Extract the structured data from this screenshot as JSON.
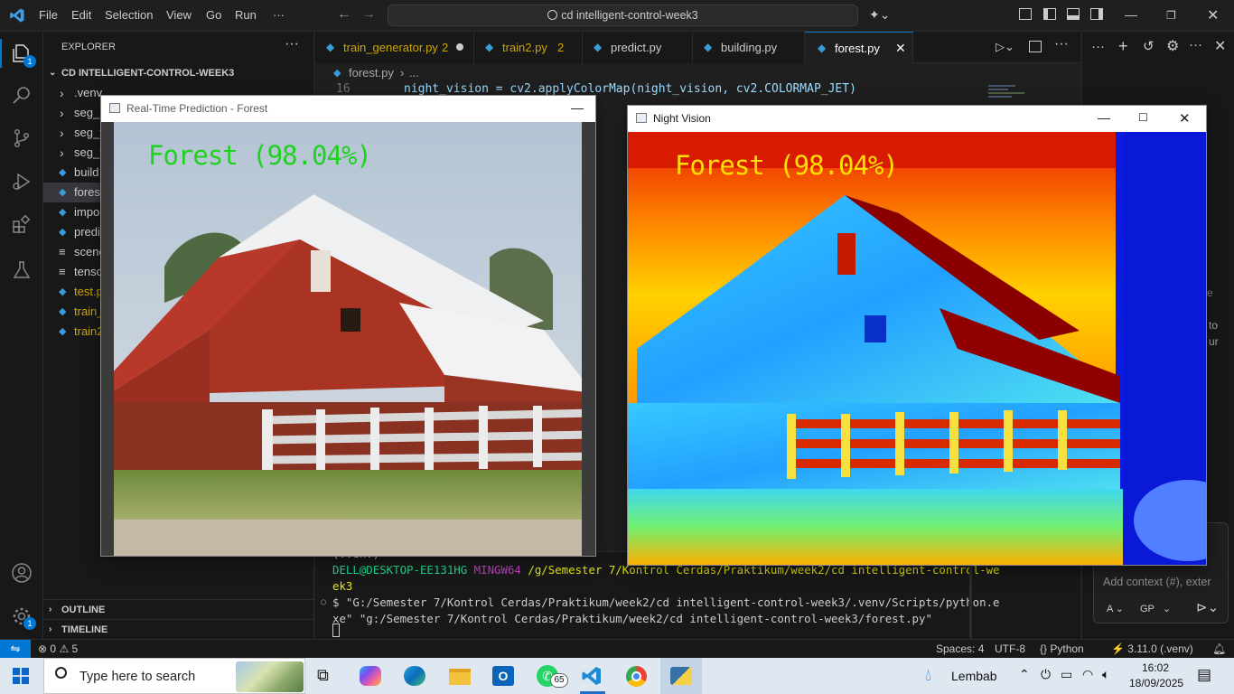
{
  "titlebar": {
    "menu": [
      "File",
      "Edit",
      "Selection",
      "View",
      "Go",
      "Run",
      "···"
    ],
    "search_text": "cd intelligent-control-week3"
  },
  "activity_bar": {
    "explorer_badge": "1",
    "settings_badge": "1"
  },
  "explorer": {
    "header": "EXPLORER",
    "folder": "CD INTELLIGENT-CONTROL-WEEK3",
    "items": [
      {
        "label": ".venv",
        "kind": "folder",
        "color": "#cccccc"
      },
      {
        "label": "seg_p",
        "kind": "folder",
        "color": "#cccccc"
      },
      {
        "label": "seg_t",
        "kind": "folder",
        "color": "#cccccc"
      },
      {
        "label": "seg_t",
        "kind": "folder",
        "color": "#cccccc"
      },
      {
        "label": "build",
        "kind": "py",
        "color": "#cccccc"
      },
      {
        "label": "fores",
        "kind": "py",
        "color": "#cccccc"
      },
      {
        "label": "impo",
        "kind": "py",
        "color": "#cccccc"
      },
      {
        "label": "predi",
        "kind": "py",
        "color": "#cccccc"
      },
      {
        "label": "scene",
        "kind": "txt",
        "color": "#cccccc"
      },
      {
        "label": "tenso",
        "kind": "txt",
        "color": "#cccccc"
      },
      {
        "label": "test.p",
        "kind": "py",
        "color": "#cca700"
      },
      {
        "label": "train_",
        "kind": "py",
        "color": "#cca700"
      },
      {
        "label": "train2",
        "kind": "py",
        "color": "#cca700"
      }
    ],
    "outline": "OUTLINE",
    "timeline": "TIMELINE"
  },
  "tabs": [
    {
      "label": "train_generator.py",
      "suffix": "2",
      "color": "#cca700",
      "dirty": true
    },
    {
      "label": "train2.py",
      "suffix": "2",
      "color": "#cca700",
      "dirty": false
    },
    {
      "label": "predict.py",
      "suffix": "",
      "color": "#cccccc",
      "dirty": false
    },
    {
      "label": "building.py",
      "suffix": "",
      "color": "#cccccc",
      "dirty": false
    },
    {
      "label": "forest.py",
      "suffix": "",
      "color": "#ffffff",
      "dirty": false
    }
  ],
  "breadcrumb": {
    "file": "forest.py",
    "rest": "..."
  },
  "code": {
    "line_number": "16",
    "line_text": "night_vision = cv2.applyColorMap(night_vision, cv2.COLORMAP_JET)"
  },
  "right_panel": {
    "context_placeholder": "Add context (#), exter",
    "agent_label": "A",
    "model_label": "GP",
    "partial_text_1": "e",
    "partial_text_2": "to",
    "partial_text_3": "ur"
  },
  "terminal": {
    "venv_line": "(.venv)",
    "prompt_user": "DELL@DESKTOP-EE131HG",
    "prompt_env": "MINGW64",
    "prompt_path": "/g/Semester 7/Kontrol Cerdas/Praktikum/week2/cd intelligent-control-we",
    "prompt_path_wrap": "ek3",
    "command_line_1": "$ \"G:/Semester 7/Kontrol Cerdas/Praktikum/week2/cd intelligent-control-week3/.venv/Scripts/python.e",
    "command_line_2": "xe\" \"g:/Semester 7/Kontrol Cerdas/Praktikum/week2/cd intelligent-control-week3/forest.py\""
  },
  "statusbar": {
    "errors": "0",
    "warnings": "5",
    "spaces": "Spaces: 4",
    "encoding": "UTF-8",
    "language": "Python",
    "interpreter": "3.11.0 (.venv)"
  },
  "window_prediction": {
    "title": "Real-Time Prediction - Forest",
    "label": "Forest (98.04%)",
    "label_color": "#1fd21f"
  },
  "window_night": {
    "title": "Night Vision",
    "label": "Forest (98.04%)",
    "label_color": "#ffe000"
  },
  "taskbar": {
    "search_placeholder": "Type here to search",
    "whatsapp_badge": "65",
    "weather": "Lembab",
    "time": "16:02",
    "date": "18/09/2025"
  }
}
